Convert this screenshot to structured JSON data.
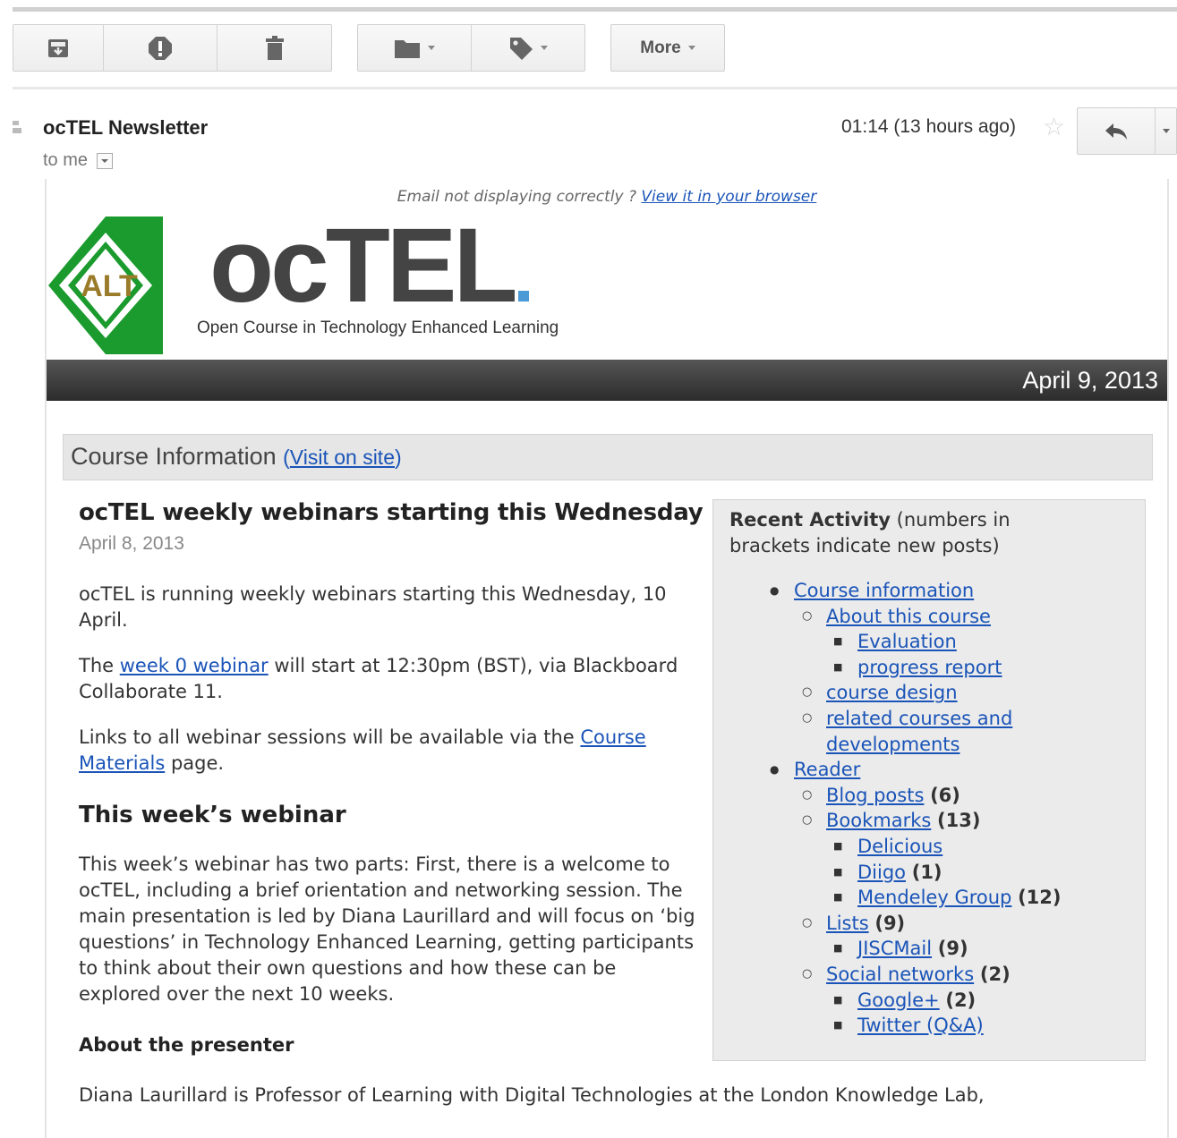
{
  "toolbar": {
    "icons": [
      "archive-icon",
      "report-spam-icon",
      "delete-icon",
      "move-to-folder-icon",
      "labels-icon"
    ],
    "more_label": "More"
  },
  "message": {
    "sender": "ocTEL Newsletter",
    "recipient": "to me",
    "time": "01:14 (13 hours ago)",
    "star_glyph": "☆"
  },
  "newsletter": {
    "display_notice": "Email not displaying correctly ?",
    "view_browser_link": "View it in your browser",
    "logo_text": "ALT",
    "brand_name": "ocTEL",
    "brand_tagline": "Open Course in Technology Enhanced Learning",
    "date": "April 9, 2013",
    "colors": {
      "logo_green": "#1b9a2e",
      "logo_gold": "#9a7b2a",
      "link": "#1a54b8"
    }
  },
  "section": {
    "title": "Course Information",
    "link_open": "(",
    "link": "Visit on site",
    "link_close": ")"
  },
  "article": {
    "title": "ocTEL weekly webinars starting this Wednesday",
    "date": "April 8, 2013",
    "p1": "ocTEL is running weekly webinars starting this Wednesday, 10 April.",
    "p2_before": "The ",
    "p2_link": "week 0 webinar",
    "p2_after": " will start at 12:30pm (BST), via Blackboard Collaborate 11.",
    "p3_before": "Links to all webinar sessions will be available via the ",
    "p3_link": "Course Materials",
    "p3_after": " page.",
    "h_webinar": "This week’s webinar",
    "p4": "This week’s webinar has two parts: First, there is a welcome to ocTEL, including a brief orientation and networking session. The main presentation is led by Diana Laurillard and will focus on ‘big questions’ in Technology Enhanced Learning, getting participants to think about their own questions and how these can be explored over the next 10 weeks.",
    "h_presenter": "About the presenter",
    "p5": "Diana Laurillard is Professor of Learning with Digital Technologies at the London Knowledge Lab,"
  },
  "sidebar": {
    "title_bold": "Recent Activity",
    "title_rest": " (numbers in brackets indicate new posts)",
    "items": [
      {
        "label": "Course information",
        "count": "",
        "level": 1
      },
      {
        "label": "About this course",
        "count": "",
        "level": 2
      },
      {
        "label": "Evaluation",
        "count": "",
        "level": 3
      },
      {
        "label": "progress report",
        "count": "",
        "level": 3
      },
      {
        "label": "course design",
        "count": "",
        "level": 2
      },
      {
        "label": "related courses and",
        "count": "",
        "level": 2
      },
      {
        "label": "developments",
        "count": "",
        "level": 0
      },
      {
        "label": "Reader",
        "count": "",
        "level": 1
      },
      {
        "label": "Blog posts",
        "count": "(6)",
        "level": 2
      },
      {
        "label": "Bookmarks",
        "count": "(13)",
        "level": 2
      },
      {
        "label": "Delicious",
        "count": "",
        "level": 3
      },
      {
        "label": "Diigo",
        "count": "(1)",
        "level": 3
      },
      {
        "label": "Mendeley Group",
        "count": "(12)",
        "level": 3
      },
      {
        "label": "Lists",
        "count": "(9)",
        "level": 2
      },
      {
        "label": "JISCMail",
        "count": "(9)",
        "level": 3
      },
      {
        "label": "Social networks",
        "count": "(2)",
        "level": 2
      },
      {
        "label": "Google+",
        "count": "(2)",
        "level": 3
      },
      {
        "label": "Twitter (Q&A)",
        "count": "",
        "level": 3
      }
    ]
  }
}
